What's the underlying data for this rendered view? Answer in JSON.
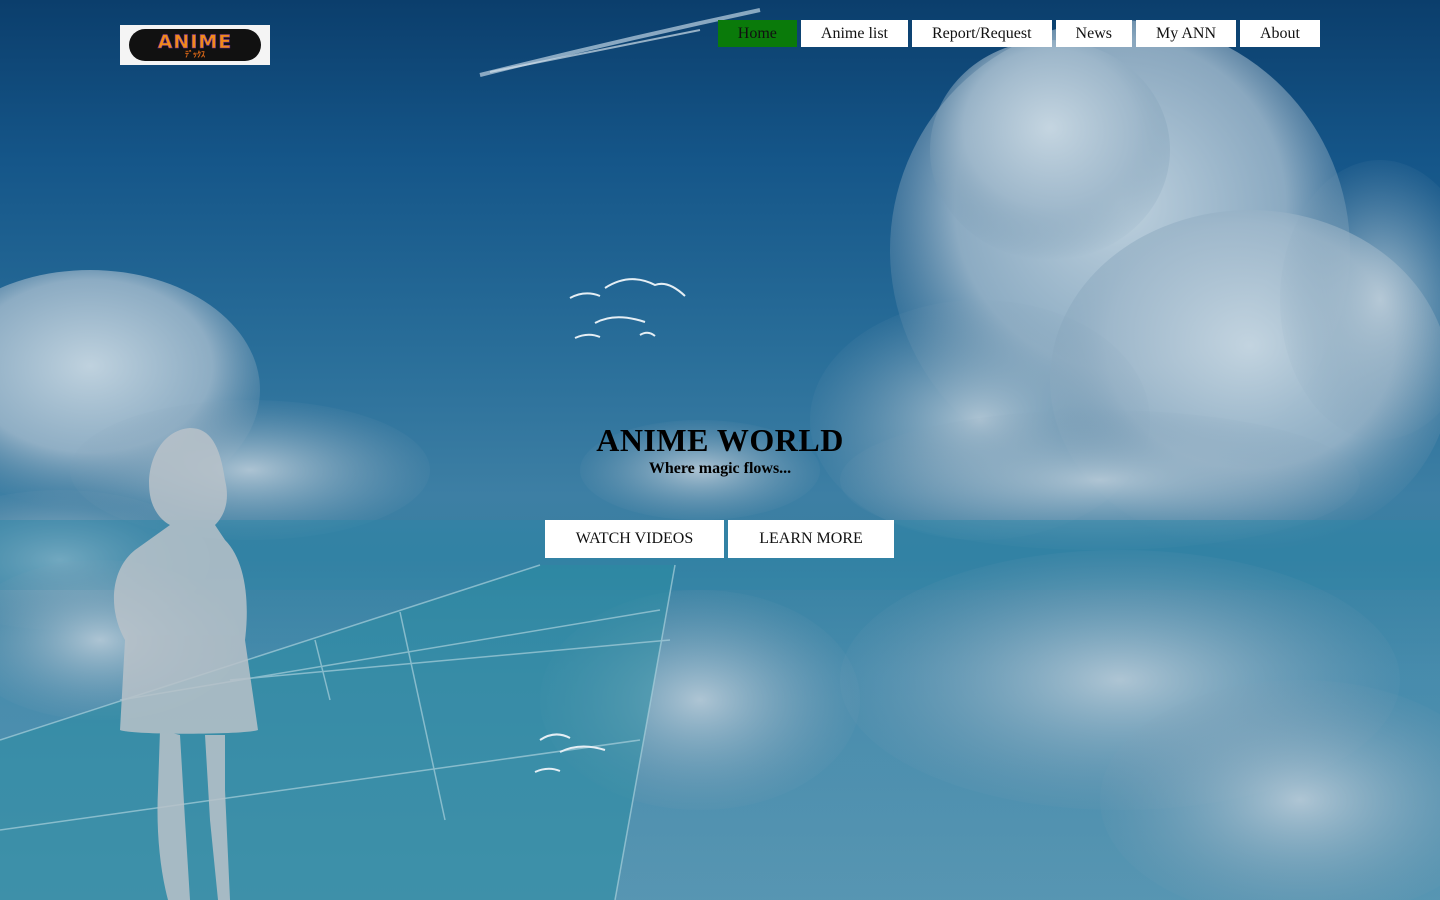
{
  "logo": {
    "text": "ANIME",
    "sub": "ﾃﾞｯｸｽ"
  },
  "nav": {
    "items": [
      {
        "label": "Home",
        "active": true
      },
      {
        "label": "Anime list",
        "active": false
      },
      {
        "label": "Report/Request",
        "active": false
      },
      {
        "label": "News",
        "active": false
      },
      {
        "label": "My ANN",
        "active": false
      },
      {
        "label": "About",
        "active": false
      }
    ]
  },
  "hero": {
    "title": "ANIME WORLD",
    "subtitle": "Where magic flows...",
    "buttons": {
      "watch": "WATCH VIDEOS",
      "learn": "LEARN MORE"
    }
  },
  "colors": {
    "active_nav": "#0a7a0a",
    "nav_bg": "#ffffff",
    "sky_top": "#0b3e6c",
    "sky_bottom": "#5f98b5"
  }
}
